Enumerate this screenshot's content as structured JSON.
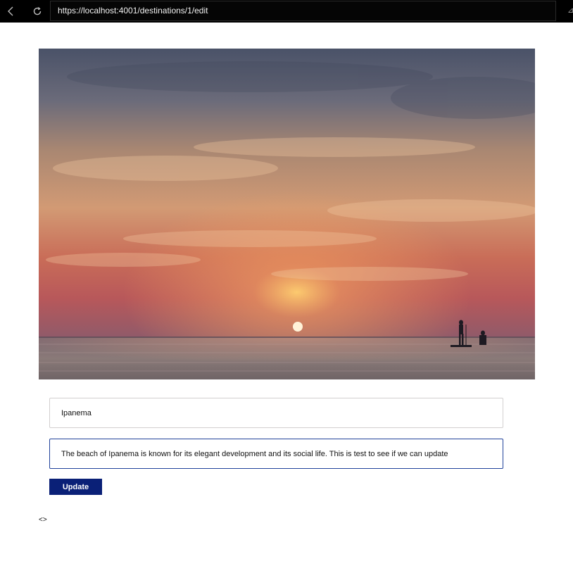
{
  "browser": {
    "url": "https://localhost:4001/destinations/1/edit"
  },
  "hero": {
    "icon": "beach-sunset-image"
  },
  "form": {
    "title_value": "Ipanema",
    "description_value": "The beach of Ipanema is known for its elegant development and its social life. This is test to see if we can update",
    "submit_label": "Update"
  },
  "footer": {
    "glyph": "<>"
  },
  "colors": {
    "chrome": "#000000",
    "button": "#0a2077",
    "focus_border": "#20419a"
  }
}
